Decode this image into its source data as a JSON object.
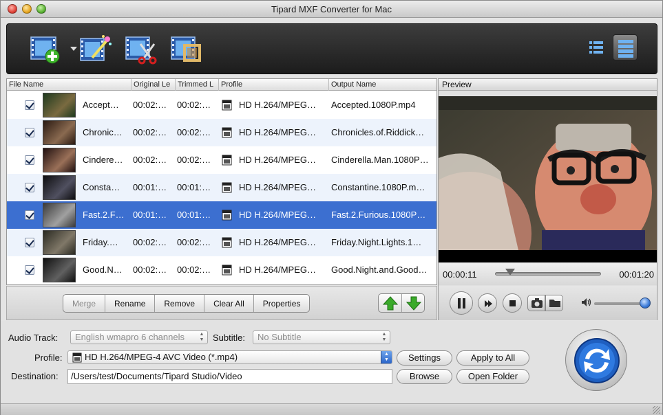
{
  "window": {
    "title": "Tipard MXF Converter for Mac"
  },
  "toolbar": {
    "icons": [
      "add-video-icon",
      "edit-effect-icon",
      "trim-clip-icon",
      "crop-video-icon",
      "list-view-icon",
      "grid-view-icon"
    ]
  },
  "columns": {
    "file_name": "File Name",
    "original_length": "Original Le",
    "trimmed_length": "Trimmed L",
    "profile": "Profile",
    "output_name": "Output Name"
  },
  "files": [
    {
      "name": "Accept…",
      "original": "00:02:…",
      "trimmed": "00:02:…",
      "profile": "HD H.264/MPEG…",
      "output": "Accepted.1080P.mp4",
      "checked": true
    },
    {
      "name": "Chronic…",
      "original": "00:02:…",
      "trimmed": "00:02:…",
      "profile": "HD H.264/MPEG…",
      "output": "Chronicles.of.Riddick…",
      "checked": true
    },
    {
      "name": "Cindere…",
      "original": "00:02:…",
      "trimmed": "00:02:…",
      "profile": "HD H.264/MPEG…",
      "output": "Cinderella.Man.1080P…",
      "checked": true
    },
    {
      "name": "Consta…",
      "original": "00:01:…",
      "trimmed": "00:01:…",
      "profile": "HD H.264/MPEG…",
      "output": "Constantine.1080P.m…",
      "checked": true
    },
    {
      "name": "Fast.2.F…",
      "original": "00:01:…",
      "trimmed": "00:01:…",
      "profile": "HD H.264/MPEG…",
      "output": "Fast.2.Furious.1080P…",
      "checked": true
    },
    {
      "name": "Friday.…",
      "original": "00:02:…",
      "trimmed": "00:02:…",
      "profile": "HD H.264/MPEG…",
      "output": "Friday.Night.Lights.1…",
      "checked": true
    },
    {
      "name": "Good.N…",
      "original": "00:02:…",
      "trimmed": "00:02:…",
      "profile": "HD H.264/MPEG…",
      "output": "Good.Night.and.Good…",
      "checked": true
    }
  ],
  "list_actions": {
    "merge": "Merge",
    "rename": "Rename",
    "remove": "Remove",
    "clear_all": "Clear All",
    "properties": "Properties"
  },
  "preview": {
    "title": "Preview",
    "current_time": "00:00:11",
    "total_time": "00:01:20",
    "seek_fraction": 0.14,
    "volume_fraction": 0.95
  },
  "settings": {
    "audio_track_label": "Audio Track:",
    "audio_track_value": "English wmapro 6 channels",
    "subtitle_label": "Subtitle:",
    "subtitle_value": "No Subtitle",
    "profile_label": "Profile:",
    "profile_value": "HD H.264/MPEG-4 AVC Video (*.mp4)",
    "destination_label": "Destination:",
    "destination_value": "/Users/test/Documents/Tipard Studio/Video",
    "settings_button": "Settings",
    "apply_all_button": "Apply to All",
    "browse_button": "Browse",
    "open_folder_button": "Open Folder"
  },
  "colors": {
    "selection": "#3c6fd0",
    "accent": "#2a64c8",
    "arrow_green": "#3aaa2a"
  }
}
